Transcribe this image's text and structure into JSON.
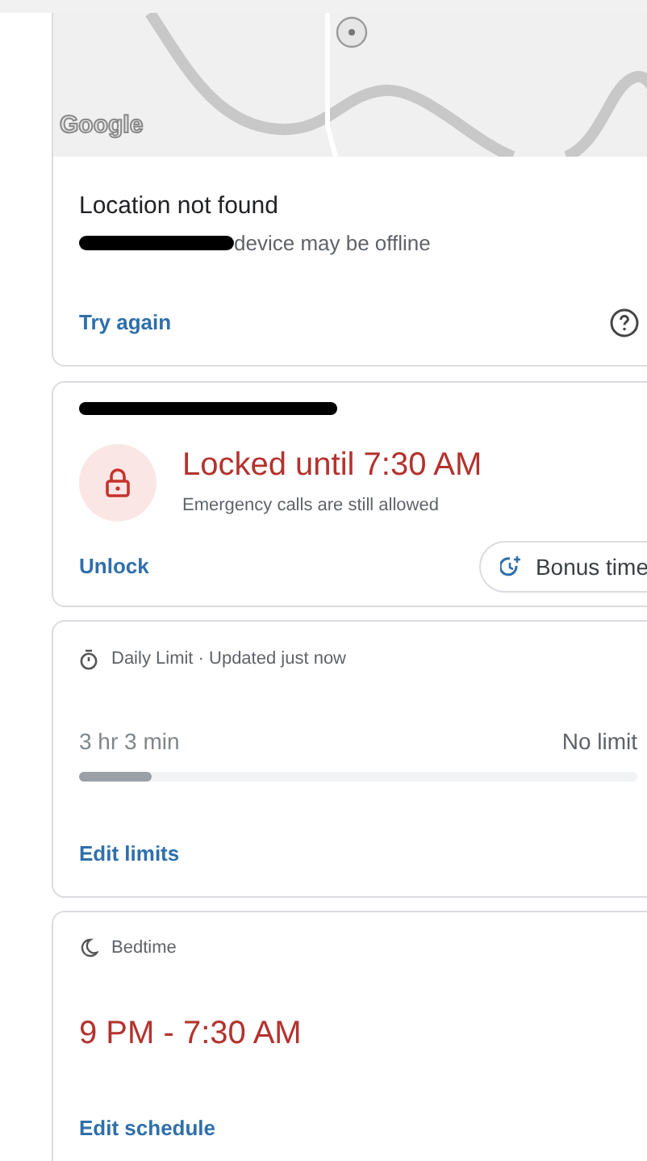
{
  "location_card": {
    "map_logo": "Google",
    "title": "Location not found",
    "subtitle": "device may be offline",
    "subtitle_redacted": true,
    "action": "Try again"
  },
  "lock_card": {
    "name_redacted": true,
    "title": "Locked until 7:30 AM",
    "subtitle": "Emergency calls are still allowed",
    "action": "Unlock",
    "chip": "Bonus time"
  },
  "limit_card": {
    "header": "Daily Limit · Updated just now",
    "used": "3 hr 3 min",
    "limit": "No limit",
    "level": 0.13,
    "action": "Edit limits"
  },
  "bedtime_card": {
    "header": "Bedtime",
    "schedule": "9 PM - 7:30 AM",
    "action": "Edit schedule"
  }
}
